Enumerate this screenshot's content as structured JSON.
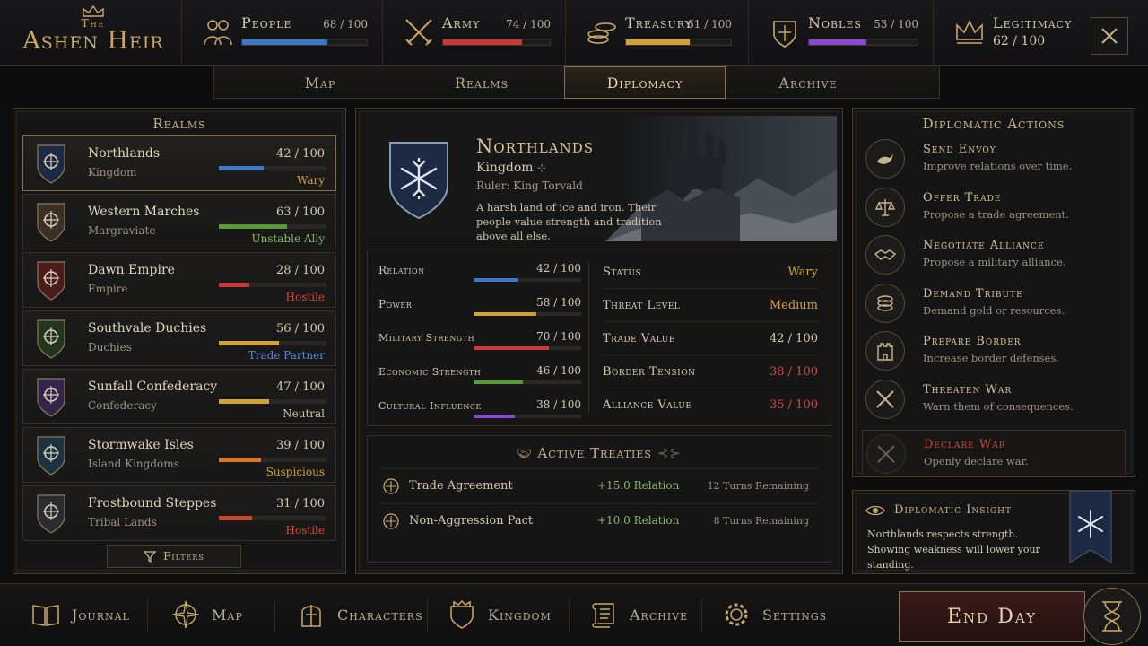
{
  "game": {
    "the": "The",
    "title": "Ashen Heir"
  },
  "stats": [
    {
      "label": "People",
      "value": "68 / 100",
      "level": 68,
      "color": "#3f78c8",
      "icon": "people-icon"
    },
    {
      "label": "Army",
      "value": "74 / 100",
      "level": 74,
      "color": "#c83a3a",
      "icon": "crossed-swords-icon"
    },
    {
      "label": "Treasury",
      "value": "61 / 100",
      "level": 61,
      "color": "#d2a23a",
      "icon": "coins-icon"
    },
    {
      "label": "Nobles",
      "value": "53 / 100",
      "level": 53,
      "color": "#8a4ad0",
      "icon": "noble-shield-icon"
    }
  ],
  "legitimacy": {
    "label": "Legitimacy",
    "value": "62 / 100",
    "icon": "crown-icon"
  },
  "tabs": [
    "Map",
    "Realms",
    "Diplomacy",
    "Archive"
  ],
  "active_tab": "Diplomacy",
  "realms_panel": {
    "title": "Realms",
    "filters_label": "Filters",
    "items": [
      {
        "name": "Northlands",
        "type": "Kingdom",
        "value": "42 / 100",
        "level": 42,
        "status": "Wary",
        "status_color": "#d2a23a",
        "bar_color": "#3f78c8",
        "shield_color": "#1c2a44",
        "emblem": "snowflake-emblem-icon"
      },
      {
        "name": "Western Marches",
        "type": "Margraviate",
        "value": "63 / 100",
        "level": 63,
        "status": "Unstable Ally",
        "status_color": "#8ab86a",
        "bar_color": "#5a9a3a",
        "shield_color": "#3a3026",
        "emblem": "lion-emblem-icon"
      },
      {
        "name": "Dawn Empire",
        "type": "Empire",
        "value": "28 / 100",
        "level": 28,
        "status": "Hostile",
        "status_color": "#d24a3a",
        "bar_color": "#c83a3a",
        "shield_color": "#4a1c1c",
        "emblem": "eagle-emblem-icon"
      },
      {
        "name": "Southvale Duchies",
        "type": "Duchies",
        "value": "56 / 100",
        "level": 56,
        "status": "Trade Partner",
        "status_color": "#5a8ad2",
        "bar_color": "#d2a23a",
        "shield_color": "#22351e",
        "emblem": "rose-emblem-icon"
      },
      {
        "name": "Sunfall Confederacy",
        "type": "Confederacy",
        "value": "47 / 100",
        "level": 47,
        "status": "Neutral",
        "status_color": "#c9c0ac",
        "bar_color": "#d2a23a",
        "shield_color": "#35244a",
        "emblem": "moon-emblem-icon"
      },
      {
        "name": "Stormwake Isles",
        "type": "Island Kingdoms",
        "value": "39 / 100",
        "level": 39,
        "status": "Suspicious",
        "status_color": "#d2a23a",
        "bar_color": "#d27a2a",
        "shield_color": "#1c3240",
        "emblem": "ship-emblem-icon"
      },
      {
        "name": "Frostbound Steppes",
        "type": "Tribal Lands",
        "value": "31 / 100",
        "level": 31,
        "status": "Hostile",
        "status_color": "#d24a3a",
        "bar_color": "#c84a2a",
        "shield_color": "#2a2c30",
        "emblem": "stag-emblem-icon"
      }
    ]
  },
  "detail": {
    "name": "Northlands",
    "type": "Kingdom",
    "ruler": "Ruler: King Torvald",
    "description": "A harsh land of ice and iron. Their people value strength and tradition above all else.",
    "stats": [
      {
        "label": "Relation",
        "value": "42 / 100",
        "level": 42,
        "color": "#3f78c8"
      },
      {
        "label": "Power",
        "value": "58 / 100",
        "level": 58,
        "color": "#d2a23a"
      },
      {
        "label": "Military Strength",
        "value": "70 / 100",
        "level": 70,
        "color": "#c83a3a"
      },
      {
        "label": "Economic Strength",
        "value": "46 / 100",
        "level": 46,
        "color": "#5a9a3a"
      },
      {
        "label": "Cultural Influence",
        "value": "38 / 100",
        "level": 38,
        "color": "#8a4ad0"
      }
    ],
    "props": [
      {
        "label": "Status",
        "value": "Wary",
        "color": "#d2a23a"
      },
      {
        "label": "Threat Level",
        "value": "Medium",
        "color": "#d2a23a"
      },
      {
        "label": "Trade Value",
        "value": "42 / 100",
        "color": "#d6c9ae"
      },
      {
        "label": "Border Tension",
        "value": "38 / 100",
        "color": "#d24a3a"
      },
      {
        "label": "Alliance Value",
        "value": "35 / 100",
        "color": "#d24a3a"
      }
    ],
    "treaties": {
      "title": "Active Treaties",
      "items": [
        {
          "name": "Trade Agreement",
          "effect": "+15.0 Relation",
          "turns": "12 Turns Remaining",
          "icon": "trade-seal-icon"
        },
        {
          "name": "Non-Aggression Pact",
          "effect": "+10.0 Relation",
          "turns": "8 Turns Remaining",
          "icon": "pact-seal-icon"
        }
      ]
    }
  },
  "actions": {
    "title": "Diplomatic Actions",
    "items": [
      {
        "name": "Send Envoy",
        "desc": "Improve relations over time.",
        "icon": "dove-icon"
      },
      {
        "name": "Offer Trade",
        "desc": "Propose a trade agreement.",
        "icon": "scales-icon"
      },
      {
        "name": "Negotiate Alliance",
        "desc": "Propose a military alliance.",
        "icon": "handshake-icon"
      },
      {
        "name": "Demand Tribute",
        "desc": "Demand gold or resources.",
        "icon": "coins-icon"
      },
      {
        "name": "Prepare Border",
        "desc": "Increase border defenses.",
        "icon": "tower-icon"
      },
      {
        "name": "Threaten War",
        "desc": "Warn them of consequences.",
        "icon": "crossed-swords-icon"
      }
    ],
    "declare_war": {
      "name": "Declare War",
      "desc": "Openly declare war.",
      "color": "#c8483a"
    }
  },
  "insight": {
    "title": "Diplomatic Insight",
    "text": "Northlands respects strength. Showing weakness will lower your standing."
  },
  "bottom_nav": [
    {
      "label": "Journal",
      "icon": "book-icon"
    },
    {
      "label": "Map",
      "icon": "compass-icon"
    },
    {
      "label": "Characters",
      "icon": "helmet-icon"
    },
    {
      "label": "Kingdom",
      "icon": "kingdom-shield-icon"
    },
    {
      "label": "Archive",
      "icon": "scroll-icon"
    },
    {
      "label": "Settings",
      "icon": "gear-icon"
    }
  ],
  "end_day_label": "End Day"
}
